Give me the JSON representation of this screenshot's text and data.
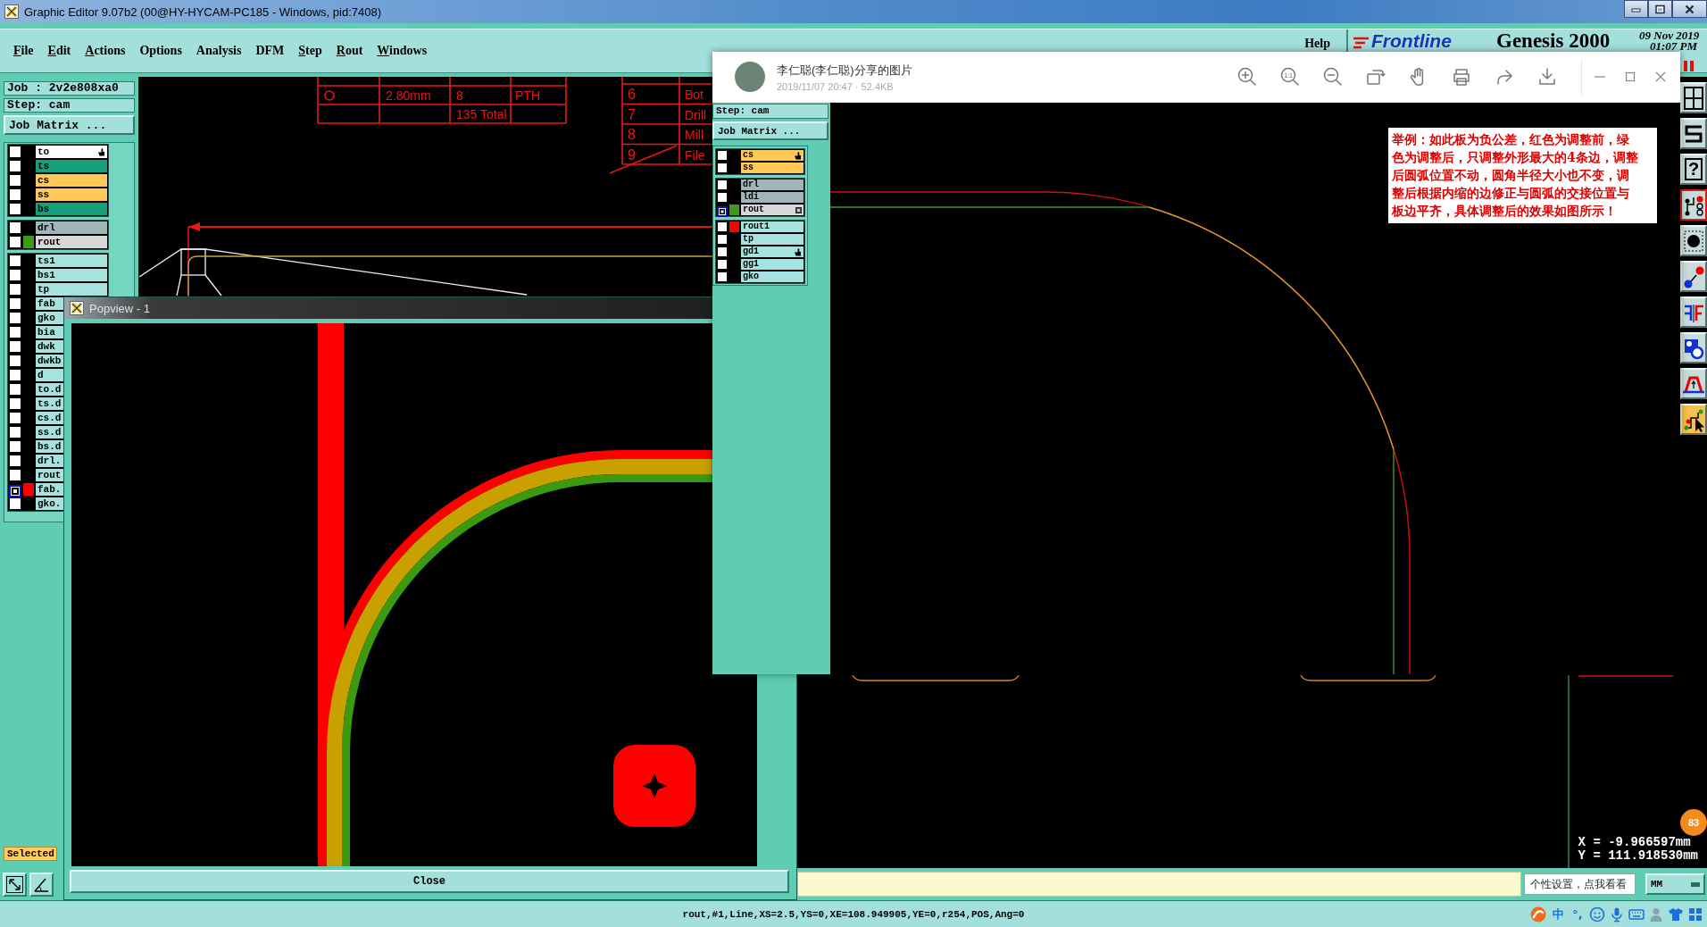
{
  "window": {
    "title": "Graphic Editor 9.07b2 (00@HY-HYCAM-PC185 - Windows, pid:7408)"
  },
  "menu": [
    {
      "label": "File",
      "mnemonic": true
    },
    {
      "label": "Edit",
      "mnemonic": true
    },
    {
      "label": "Actions",
      "mnemonic": true
    },
    {
      "label": "Options",
      "mnemonic": false
    },
    {
      "label": "Analysis",
      "mnemonic": false
    },
    {
      "label": "DFM",
      "mnemonic": false
    },
    {
      "label": "Step",
      "mnemonic": true
    },
    {
      "label": "Rout",
      "mnemonic": true
    },
    {
      "label": "Windows",
      "mnemonic": true
    }
  ],
  "help_menu": "Help",
  "brand": {
    "logo": "Frontline",
    "product": "Genesis 2000",
    "date": "09 Nov 2019",
    "time": "01:07 PM"
  },
  "job_panel": {
    "job": "Job : 2v2e808xa0",
    "step": "Step: cam",
    "matrix_button": "Job Matrix ...",
    "layer_groups": [
      [
        {
          "name": "to",
          "kind": "hand",
          "color": "#ffffff",
          "work": false
        },
        {
          "name": "ts",
          "kind": "plain",
          "color": "#14a07a",
          "work": false
        },
        {
          "name": "cs",
          "kind": "plain",
          "color": "#ffc857",
          "work": false
        },
        {
          "name": "ss",
          "kind": "plain",
          "color": "#ffc857",
          "work": false
        },
        {
          "name": "bs",
          "kind": "plain",
          "color": "#14a07a",
          "work": false
        }
      ],
      [
        {
          "name": "drl",
          "kind": "plain",
          "color": "#a0b5b9",
          "work": false
        },
        {
          "name": "rout",
          "kind": "plain",
          "color": "#d8d8d8",
          "work": false,
          "swatch": {
            "color": "#3e9a18"
          }
        }
      ],
      [
        {
          "name": "ts1",
          "kind": "plain",
          "color": "#a6e2e0",
          "work": false
        },
        {
          "name": "bs1",
          "kind": "plain",
          "color": "#a6e2e0",
          "work": false
        },
        {
          "name": "tp",
          "kind": "plain",
          "color": "#a6e2e0",
          "work": false
        },
        {
          "name": "fab",
          "kind": "plain",
          "color": "#a6e2e0",
          "work": false
        },
        {
          "name": "gko",
          "kind": "plain",
          "color": "#a6e2e0",
          "work": false
        },
        {
          "name": "bia",
          "kind": "plain",
          "color": "#a6e2e0",
          "work": false
        },
        {
          "name": "dwk",
          "kind": "plain",
          "color": "#a6e2e0",
          "work": false
        },
        {
          "name": "dwkb",
          "kind": "plain",
          "color": "#a6e2e0",
          "work": false
        },
        {
          "name": "d",
          "kind": "plain",
          "color": "#a6e2e0",
          "work": false
        },
        {
          "name": "to.d",
          "kind": "plain",
          "color": "#a6e2e0",
          "work": false
        },
        {
          "name": "ts.d",
          "kind": "plain",
          "color": "#a6e2e0",
          "work": false
        },
        {
          "name": "cs.d",
          "kind": "plain",
          "color": "#a6e2e0",
          "work": false
        },
        {
          "name": "ss.d",
          "kind": "plain",
          "color": "#a6e2e0",
          "work": false
        },
        {
          "name": "bs.d",
          "kind": "plain",
          "color": "#a6e2e0",
          "work": false
        },
        {
          "name": "drl.",
          "kind": "plain",
          "color": "#a6e2e0",
          "work": false
        },
        {
          "name": "rout",
          "kind": "plain",
          "color": "#a6e2e0",
          "work": false
        },
        {
          "name": "fab.",
          "kind": "plain",
          "color": "#a6e2e0",
          "work": true,
          "swatch": {
            "color": "#ff0000"
          }
        },
        {
          "name": "gko.",
          "kind": "plain",
          "color": "#a6e2e0",
          "work": false
        }
      ]
    ],
    "selected_label": "Selected"
  },
  "canvas": {
    "drill_table": {
      "rows": [
        {
          "size": "2.80mm",
          "count": "8",
          "type": "PTH"
        }
      ],
      "total": "135 Total"
    },
    "index_table": [
      {
        "number": "6",
        "text": "Bot"
      },
      {
        "number": "7",
        "text": "Drill"
      },
      {
        "number": "8",
        "text": "Mill"
      },
      {
        "number": "9",
        "text": "File"
      }
    ],
    "coordinates": {
      "x": "X = -9.966597mm",
      "y": "Y = 111.918530mm"
    }
  },
  "notification_badge": "83",
  "tools": [
    {
      "kind": "layout",
      "selected": false,
      "flagged": false
    },
    {
      "kind": "snake",
      "selected": false,
      "flagged": false
    },
    {
      "kind": "help",
      "glyph": "?",
      "selected": false,
      "flagged": false
    },
    {
      "kind": "circuit",
      "selected": false,
      "flagged": true
    },
    {
      "kind": "pad",
      "selected": false,
      "flagged": false
    },
    {
      "kind": "connect",
      "selected": false,
      "flagged": false
    },
    {
      "kind": "split",
      "selected": false,
      "flagged": false
    },
    {
      "kind": "shapes",
      "selected": false,
      "flagged": false
    },
    {
      "kind": "profile",
      "selected": false,
      "flagged": false
    },
    {
      "kind": "route",
      "selected": true,
      "flagged": false
    }
  ],
  "popview": {
    "title": "Popview - 1",
    "close_button": "Close"
  },
  "image_viewer": {
    "title": "李仁聪(李仁聪)分享的图片",
    "meta": "2019/11/07 20:47 · 52.4KB",
    "toolbar": [
      {
        "kind": "zoom_in"
      },
      {
        "kind": "actual_size",
        "label": "1:1"
      },
      {
        "kind": "zoom_out"
      },
      {
        "kind": "rotate"
      },
      {
        "kind": "pan"
      },
      {
        "kind": "print"
      },
      {
        "kind": "share"
      },
      {
        "kind": "download"
      }
    ],
    "inset": {
      "step": "Step: cam",
      "matrix_button": "Job Matrix ...",
      "layer_groups": [
        [
          {
            "name": "cs",
            "kind": "hand",
            "color": "#ffc857",
            "work": false
          },
          {
            "name": "ss",
            "kind": "plain",
            "color": "#ffc857",
            "work": false
          }
        ],
        [
          {
            "name": "drl",
            "kind": "plain",
            "color": "#a0b5b9",
            "work": false
          },
          {
            "name": "ldi",
            "kind": "plain",
            "color": "#a0b5b9",
            "work": false
          },
          {
            "name": "rout",
            "kind": "box",
            "color": "#d8d8d8",
            "work": true,
            "swatch": {
              "color": "#3e9a18"
            }
          }
        ],
        [
          {
            "name": "rout1",
            "kind": "plain",
            "color": "#a6e2e0",
            "work": false,
            "swatch": {
              "color": "#ff0000"
            }
          },
          {
            "name": "tp",
            "kind": "plain",
            "color": "#a6e2e0",
            "work": false
          },
          {
            "name": "gd1",
            "kind": "hand",
            "color": "#a6e2e0",
            "work": false
          },
          {
            "name": "gg1",
            "kind": "plain",
            "color": "#a6e2e0",
            "work": false
          },
          {
            "name": "gko",
            "kind": "plain",
            "color": "#a6e2e0",
            "work": false
          }
        ]
      ]
    },
    "note": "举例：如此板为负公差，红色为调整前，绿色为调整后，只调整外形最大的4条边，调整后圆弧位置不动，圆角半径大小也不变，调整后根据内缩的边修正与圆弧的交接位置与板边平齐，具体调整后的效果如图所示！"
  },
  "message_bar": {
    "tooltip": "个性设置，点我看看",
    "units": "MM"
  },
  "status_bar": {
    "text": "rout,#1,Line,XS=2.5,YS=0,XE=108.949905,YE=0,r254,POS,Ang=0",
    "ime_mode": "中",
    "punctuation": "°,"
  }
}
